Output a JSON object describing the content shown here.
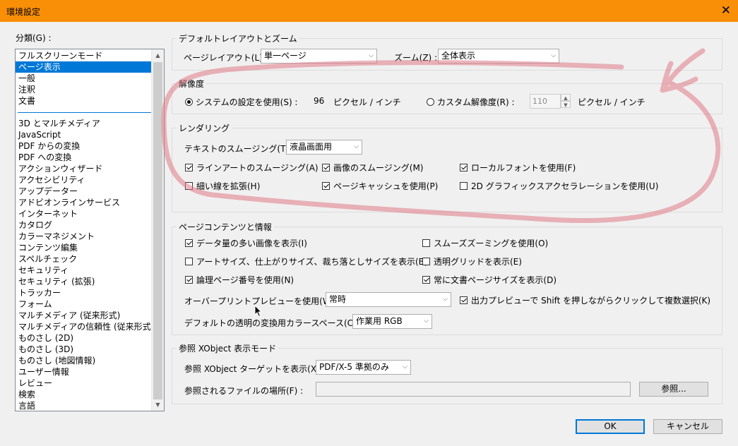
{
  "window": {
    "title": "環境設定",
    "close_glyph": "✕"
  },
  "categories": {
    "label": "分類(G) :",
    "items": [
      "フルスクリーンモード",
      "ページ表示",
      "一般",
      "注釈",
      "文書",
      "3D とマルチメディア",
      "JavaScript",
      "PDF からの変換",
      "PDF への変換",
      "アクションウィザード",
      "アクセシビリティ",
      "アップデーター",
      "アドビオンラインサービス",
      "インターネット",
      "カタログ",
      "カラーマネジメント",
      "コンテンツ編集",
      "スペルチェック",
      "セキュリティ",
      "セキュリティ (拡張)",
      "トラッカー",
      "フォーム",
      "マルチメディア (従来形式)",
      "マルチメディアの信頼性 (従来形式)",
      "ものさし (2D)",
      "ものさし (3D)",
      "ものさし (地図情報)",
      "ユーザー情報",
      "レビュー",
      "検索",
      "言語"
    ],
    "selected": "ページ表示"
  },
  "default_layout": {
    "legend": "デフォルトレイアウトとズーム",
    "layout_label": "ページレイアウト(L) :",
    "layout_value": "単一ページ",
    "zoom_label": "ズーム(Z) :",
    "zoom_value": "全体表示"
  },
  "resolution": {
    "legend": "解像度",
    "system_label": "システムの設定を使用(S) :",
    "system_value": "96",
    "system_unit": "ピクセル / インチ",
    "custom_label": "カスタム解像度(R) :",
    "custom_value": "110",
    "custom_unit": "ピクセル / インチ",
    "selected": "system"
  },
  "rendering": {
    "legend": "レンダリング",
    "smoothing_label": "テキストのスムージング(T) :",
    "smoothing_value": "液晶画面用",
    "lineart": "ラインアートのスムージング(A)",
    "image_smooth": "画像のスムージング(M)",
    "local_fonts": "ローカルフォントを使用(F)",
    "thin_lines": "細い線を拡張(H)",
    "page_cache": "ページキャッシュを使用(P)",
    "gpu": "2D グラフィックスアクセラレーションを使用(U)"
  },
  "page_content": {
    "legend": "ページコンテンツと情報",
    "large_images": "データ量の多い画像を表示(I)",
    "smooth_zoom": "スムーズズーミングを使用(O)",
    "art_size": "アートサイズ、仕上がりサイズ、裁ち落としサイズを表示(B)",
    "transparency_grid": "透明グリッドを表示(E)",
    "logical_page": "論理ページ番号を使用(N)",
    "doc_page_size": "常に文書ページサイズを表示(D)",
    "overprint_label": "オーバープリントプレビューを使用(W) :",
    "overprint_value": "常時",
    "output_preview": "出力プレビューで Shift を押しながらクリックして複数選択(K)",
    "blend_label": "デフォルトの透明の変換用カラースペース(C) :",
    "blend_value": "作業用 RGB"
  },
  "xobject": {
    "legend": "参照 XObject 表示モード",
    "target_label": "参照 XObject ターゲットを表示(X) :",
    "target_value": "PDF/X-5 準拠のみ",
    "location_label": "参照されるファイルの場所(F) :",
    "location_value": "",
    "browse": "参照..."
  },
  "buttons": {
    "ok": "OK",
    "cancel": "キャンセル"
  },
  "colors": {
    "title_bar": "#f98f06",
    "selection": "#0078d7",
    "annotation": "#e07a86"
  },
  "icons": [
    "close-icon",
    "chevron-down-icon",
    "scroll-up-icon",
    "scroll-down-icon",
    "mouse-cursor-icon"
  ]
}
